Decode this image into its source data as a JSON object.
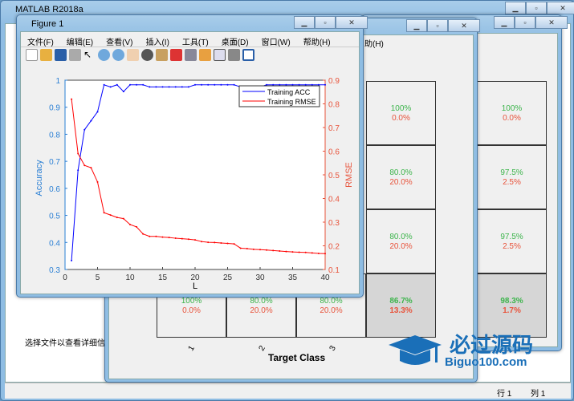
{
  "main_window": {
    "title": "MATLAB R2018a",
    "details_label": "选择文件以查看详细信息",
    "status_row": "行 1",
    "status_col": "列 1"
  },
  "confusion_window": {
    "menu_help": "助(H)",
    "xlabel": "Target Class",
    "xticks": [
      "1",
      "2",
      "3"
    ],
    "right_col": [
      [
        "100%",
        "0.0%"
      ],
      [
        "80.0%",
        "20.0%"
      ],
      [
        "80.0%",
        "20.0%"
      ],
      [
        "86.7%",
        "13.3%"
      ]
    ],
    "bottom_row": [
      [
        "100%",
        "0.0%"
      ],
      [
        "80.0%",
        "20.0%"
      ],
      [
        "80.0%",
        "20.0%"
      ]
    ]
  },
  "confusion_window2": {
    "right_col": [
      [
        "100%",
        "0.0%"
      ],
      [
        "97.5%",
        "2.5%"
      ],
      [
        "97.5%",
        "2.5%"
      ],
      [
        "98.3%",
        "1.7%"
      ]
    ]
  },
  "figure": {
    "title": "Figure 1",
    "menu": [
      "文件(F)",
      "编辑(E)",
      "查看(V)",
      "插入(I)",
      "工具(T)",
      "桌面(D)",
      "窗口(W)",
      "帮助(H)"
    ]
  },
  "watermark": {
    "text": "必过源码",
    "url": "Biguo100.com"
  },
  "chart_data": {
    "type": "line",
    "xlabel": "L",
    "ylabel": "Accuracy",
    "y2label": "RMSE",
    "xlim": [
      0,
      40
    ],
    "ylim": [
      0.3,
      1
    ],
    "y2lim": [
      0.1,
      0.9
    ],
    "xticks": [
      "0",
      "5",
      "10",
      "15",
      "20",
      "25",
      "30",
      "35",
      "40"
    ],
    "yticks": [
      "0.3",
      "0.4",
      "0.5",
      "0.6",
      "0.7",
      "0.8",
      "0.9",
      "1"
    ],
    "y2ticks": [
      "0.1",
      "0.2",
      "0.3",
      "0.4",
      "0.5",
      "0.6",
      "0.7",
      "0.8",
      "0.9"
    ],
    "legend_position": "top-right",
    "x": [
      1,
      2,
      3,
      4,
      5,
      6,
      7,
      8,
      9,
      10,
      11,
      12,
      13,
      14,
      15,
      16,
      17,
      18,
      19,
      20,
      21,
      22,
      23,
      24,
      25,
      26,
      27,
      28,
      29,
      30,
      31,
      32,
      33,
      34,
      35,
      36,
      37,
      38,
      39,
      40
    ],
    "series": [
      {
        "name": "Training ACC",
        "axis": "left",
        "color": "#0000ff",
        "values": [
          0.333,
          0.667,
          0.817,
          0.85,
          0.883,
          0.983,
          0.975,
          0.983,
          0.958,
          0.983,
          0.983,
          0.983,
          0.975,
          0.975,
          0.975,
          0.975,
          0.975,
          0.975,
          0.975,
          0.983,
          0.983,
          0.983,
          0.983,
          0.983,
          0.983,
          0.983,
          0.975,
          0.975,
          0.975,
          0.975,
          0.983,
          0.983,
          0.983,
          0.983,
          0.983,
          0.983,
          0.983,
          0.983,
          0.983,
          0.983
        ]
      },
      {
        "name": "Training RMSE",
        "axis": "right",
        "color": "#ff0000",
        "values": [
          0.82,
          0.59,
          0.54,
          0.53,
          0.47,
          0.34,
          0.33,
          0.32,
          0.315,
          0.29,
          0.28,
          0.25,
          0.24,
          0.24,
          0.237,
          0.235,
          0.232,
          0.23,
          0.228,
          0.225,
          0.218,
          0.215,
          0.214,
          0.212,
          0.21,
          0.208,
          0.19,
          0.188,
          0.185,
          0.184,
          0.182,
          0.18,
          0.178,
          0.176,
          0.174,
          0.173,
          0.172,
          0.17,
          0.168,
          0.167
        ]
      }
    ]
  }
}
